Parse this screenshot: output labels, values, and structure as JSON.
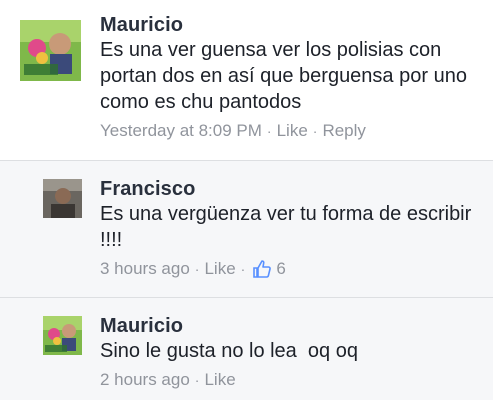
{
  "comments": [
    {
      "author": "Mauricio",
      "text": "Es una ver guensa ver los polisias con portan dos en así que berguensa por uno como es chu pantodos",
      "timestamp": "Yesterday at 8:09 PM",
      "like_label": "Like",
      "reply_label": "Reply",
      "separator": "·"
    },
    {
      "author": "Francisco",
      "text": "Es una vergüenza ver tu forma de escribir !!!!",
      "timestamp": "3 hours ago",
      "like_label": "Like",
      "separator": "·",
      "like_count": "6"
    },
    {
      "author": "Mauricio",
      "text": "Sino le gusta no lo lea  oq oq",
      "timestamp": "2 hours ago",
      "like_label": "Like",
      "separator": "·"
    }
  ],
  "colors": {
    "author": "#29303d",
    "text": "#1d2129",
    "meta": "#90949c",
    "reply_bg": "#f6f7f9",
    "like_icon": "#5890ff"
  }
}
